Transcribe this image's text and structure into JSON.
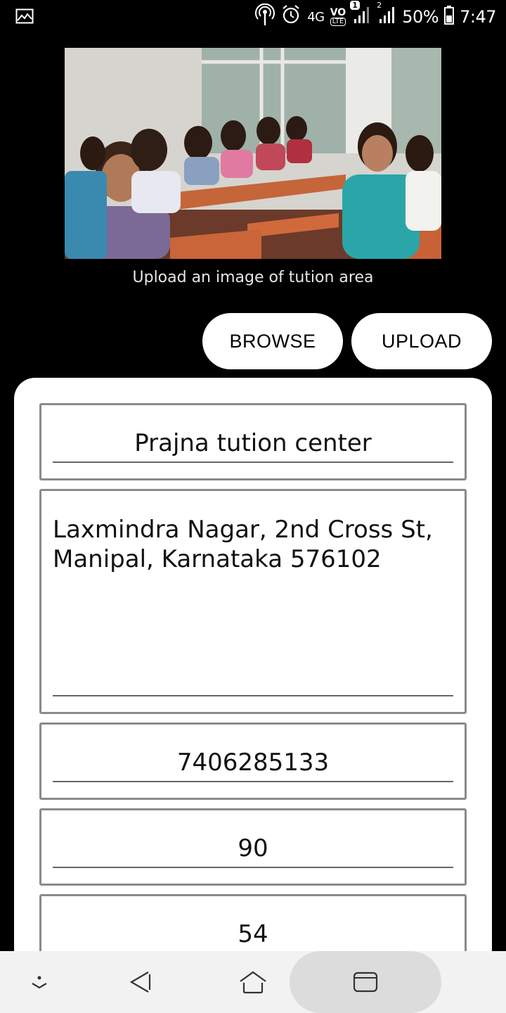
{
  "status_bar": {
    "network": "4G",
    "volte": "VO",
    "lte": "LTE",
    "sim1_badge": "1",
    "sim2_badge": "2",
    "battery": "50%",
    "time": "7:47"
  },
  "image_section": {
    "caption": "Upload an image of tution area"
  },
  "actions": {
    "browse_label": "BROWSE",
    "upload_label": "UPLOAD"
  },
  "form": {
    "name_value": "Prajna tution center",
    "address_line1": "Laxmindra Nagar, 2nd Cross St,",
    "address_line2": "Manipal, Karnataka 576102",
    "phone_value": "7406285133",
    "field4_value": "90",
    "field5_value": "54"
  },
  "nav_bar": {
    "icons": [
      "notification-down-icon",
      "back-icon",
      "home-icon",
      "recents-icon"
    ]
  }
}
